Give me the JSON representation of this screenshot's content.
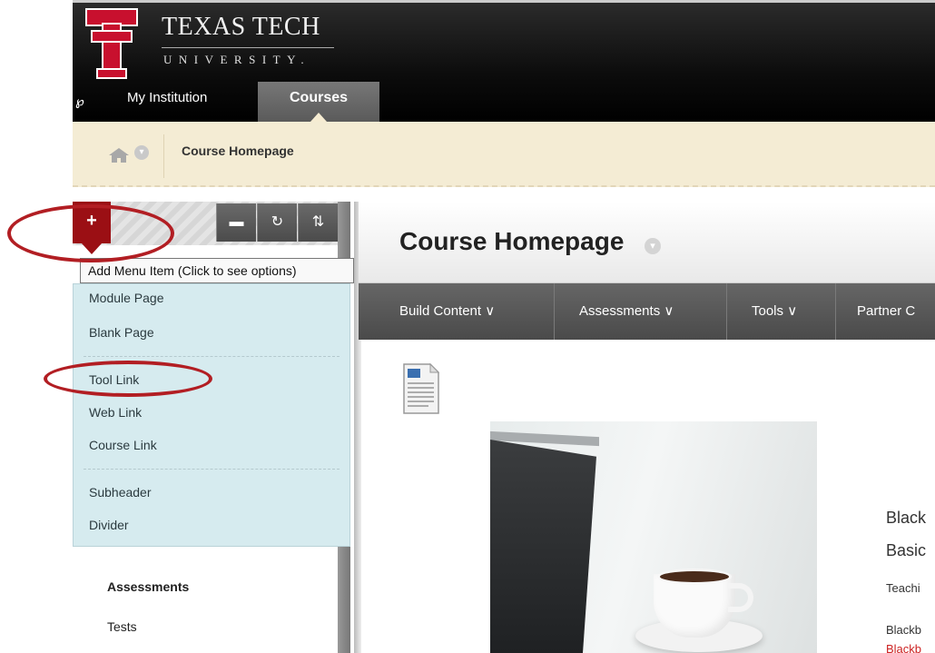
{
  "header": {
    "logo_title": "TEXAS TECH",
    "logo_sub": "UNIVERSITY.",
    "tabs": [
      "My Institution",
      "Courses"
    ]
  },
  "breadcrumb": {
    "current": "Course Homepage"
  },
  "left_panel": {
    "add_button": "+",
    "tooltip": "Add Menu Item (Click to see options)",
    "menu": {
      "group1": [
        "Module Page",
        "Blank Page"
      ],
      "group2": [
        "Tool Link",
        "Web Link",
        "Course Link"
      ],
      "group3": [
        "Subheader",
        "Divider"
      ]
    },
    "below": {
      "section": "Assessments",
      "item": "Tests"
    }
  },
  "main": {
    "title": "Course Homepage",
    "actions": [
      "Build Content",
      "Assessments",
      "Tools",
      "Partner C"
    ],
    "cut_text": [
      "Black",
      "Basic",
      "Teachi",
      "Blackb",
      "Blackb"
    ]
  },
  "colors": {
    "accent_red": "#9b0f14",
    "annotation": "#b21e23",
    "menu_bg": "#d6ebef",
    "breadcrumb_bg": "#f4ecd4"
  },
  "icons": [
    "quick-links-icon",
    "home-icon",
    "chevron-down-icon",
    "folder-icon",
    "refresh-icon",
    "sort-icon",
    "document-icon"
  ]
}
